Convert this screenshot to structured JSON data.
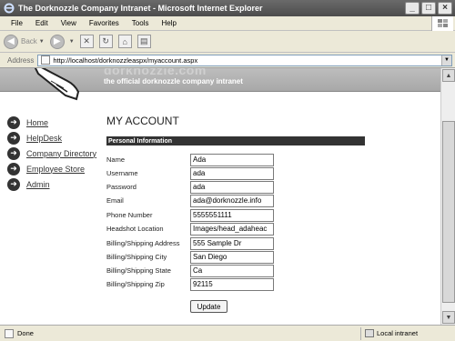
{
  "window": {
    "title": "The Dorknozzle Company Intranet - Microsoft Internet Explorer"
  },
  "menu": [
    "File",
    "Edit",
    "View",
    "Favorites",
    "Tools",
    "Help"
  ],
  "toolbar": {
    "back_label": "Back"
  },
  "address": {
    "label": "Address",
    "url": "http://localhost/dorknozzleaspx/myaccount.aspx"
  },
  "site": {
    "logo_text": "dorknozzle.com",
    "tagline": "the official dorknozzle company intranet"
  },
  "nav": [
    {
      "label": "Home"
    },
    {
      "label": "HelpDesk"
    },
    {
      "label": "Company Directory"
    },
    {
      "label": "Employee Store"
    },
    {
      "label": "Admin"
    }
  ],
  "page": {
    "title": "MY ACCOUNT",
    "section": "Personal Information",
    "fields": [
      {
        "label": "Name",
        "value": "Ada"
      },
      {
        "label": "Username",
        "value": "ada"
      },
      {
        "label": "Password",
        "value": "ada"
      },
      {
        "label": "Email",
        "value": "ada@dorknozzle.info"
      },
      {
        "label": "Phone Number",
        "value": "5555551111"
      },
      {
        "label": "Headshot Location",
        "value": "Images/head_adaheac"
      },
      {
        "label": "Billing/Shipping Address",
        "value": "555 Sample Dr"
      },
      {
        "label": "Billing/Shipping City",
        "value": "San Diego"
      },
      {
        "label": "Billing/Shipping State",
        "value": "Ca"
      },
      {
        "label": "Billing/Shipping Zip",
        "value": "92115"
      }
    ],
    "update_label": "Update"
  },
  "status": {
    "text": "Done",
    "zone": "Local intranet"
  },
  "colors": {
    "titlebar": "#5a5a5a",
    "header": "#b0b0b0",
    "section_bar": "#333333"
  }
}
